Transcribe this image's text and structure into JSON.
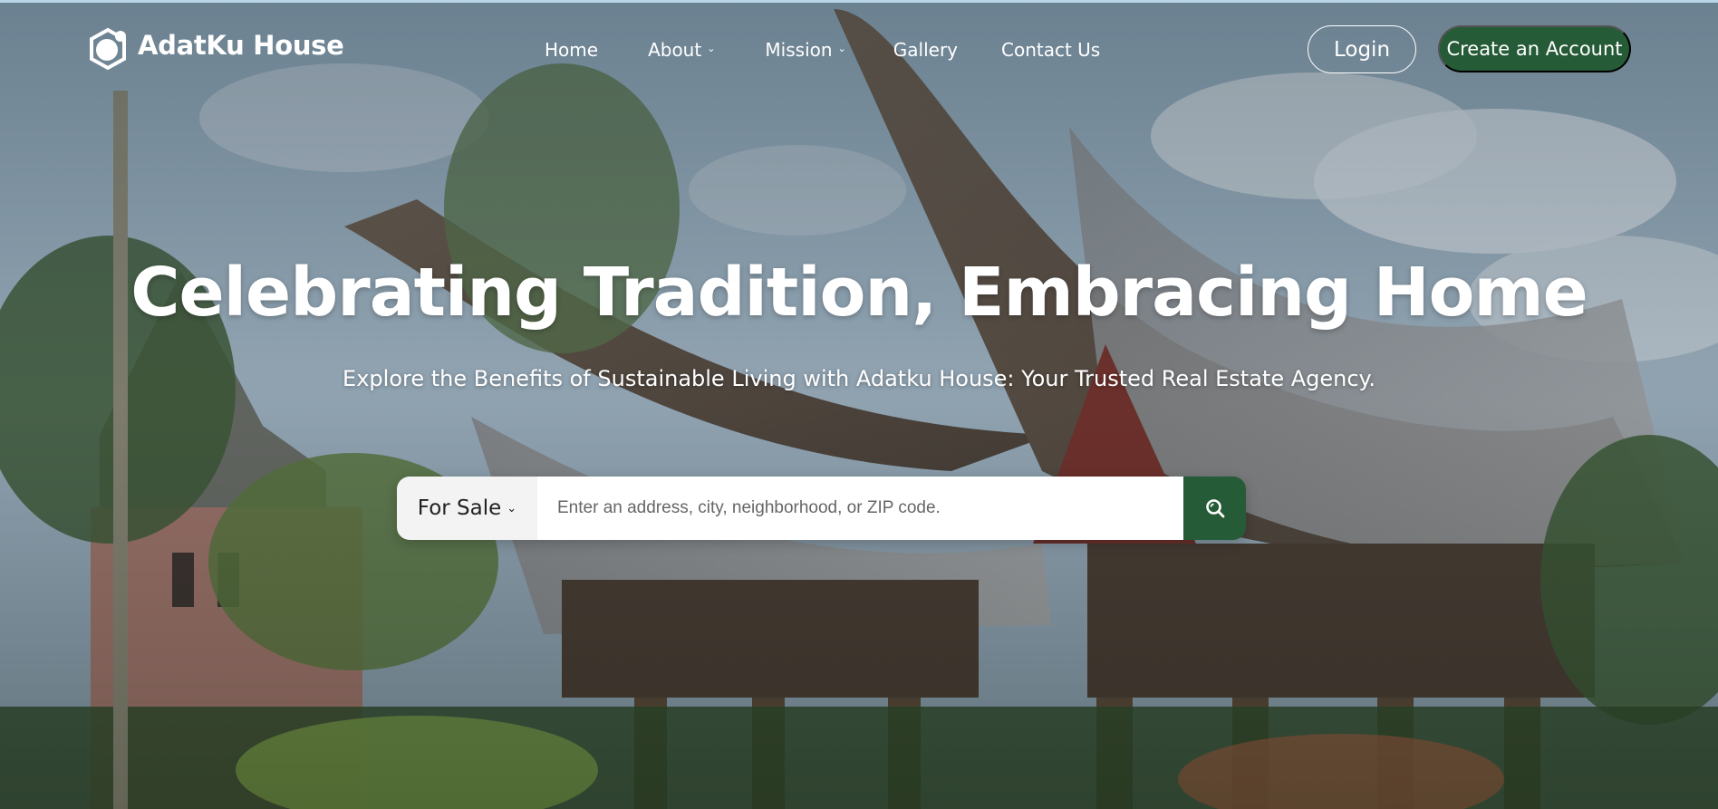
{
  "brand": {
    "name": "AdatKu House",
    "logo_icon": "hexagon-circle-logo"
  },
  "nav": {
    "items": [
      {
        "label": "Home",
        "has_dropdown": false
      },
      {
        "label": "About",
        "has_dropdown": true
      },
      {
        "label": "Mission",
        "has_dropdown": true
      },
      {
        "label": "Gallery",
        "has_dropdown": false
      },
      {
        "label": "Contact Us",
        "has_dropdown": false
      }
    ],
    "login_label": "Login",
    "create_label": "Create an Account"
  },
  "hero": {
    "headline": "Celebrating Tradition, Embracing Home",
    "subtitle": "Explore the Benefits of Sustainable Living with Adatku House: Your Trusted Real Estate Agency."
  },
  "search": {
    "type_label": "For Sale",
    "placeholder": "Enter an address, city, neighborhood, or ZIP code.",
    "button_icon": "search-icon"
  },
  "colors": {
    "accent": "#265b37",
    "text_on_image": "#ffffff"
  }
}
